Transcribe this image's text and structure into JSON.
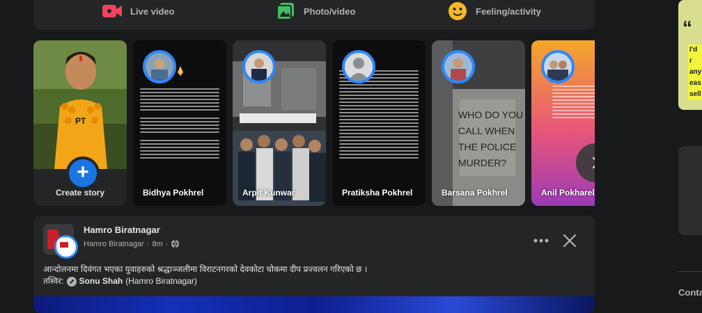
{
  "composer": {
    "actions": [
      {
        "label": "Live video",
        "icon": "live-video-icon",
        "color": "#f3425f"
      },
      {
        "label": "Photo/video",
        "icon": "photo-video-icon",
        "color": "#45bd62"
      },
      {
        "label": "Feeling/activity",
        "icon": "feeling-activity-icon",
        "color": "#f7b928"
      }
    ]
  },
  "stories": {
    "create_label": "Create story",
    "items": [
      {
        "name": "Bidhya Pokhrel"
      },
      {
        "name": "Arpit Kunwar"
      },
      {
        "name": "Pratiksha Pokhrel"
      },
      {
        "name": "Barsana Pokhrel"
      },
      {
        "name": "Anil Pokharel"
      }
    ]
  },
  "post": {
    "page_name": "Hamro Biratnagar",
    "meta_name": "Hamro Biratnagar",
    "time": "8m",
    "text": "आन्दोलनमा दिवंगत भएका युवाहरुको श्रद्धाञ्जलीमा विराटनगरको देवकोटा चोकमा दीप प्रज्वलन गरिएको छ ।",
    "credit_prefix": "तस्विर:",
    "credit_author": "Sonu Shah",
    "credit_page": "(Hamro Biratnagar)"
  },
  "sidebar": {
    "ad_lines": [
      "I'd r",
      "any",
      "eas",
      "sell"
    ],
    "contacts_label": "Conta"
  },
  "colors": {
    "accent": "#2d88ff",
    "create_button": "#1b74e4",
    "background": "#18191a",
    "card": "#242526"
  }
}
